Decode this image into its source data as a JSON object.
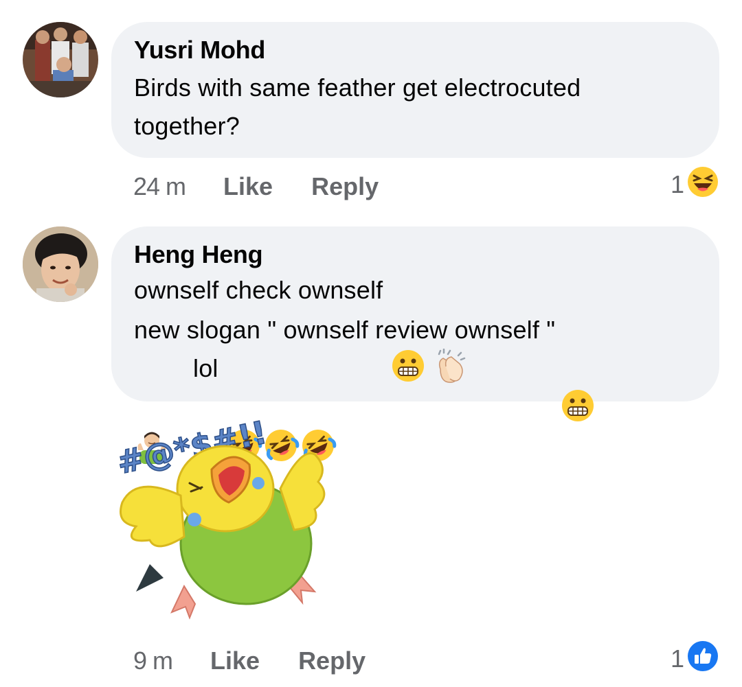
{
  "comments": [
    {
      "author": "Yusri Mohd",
      "lines": [
        "Birds with same feather get electrocuted",
        "together?"
      ],
      "time": "24 m",
      "like_label": "Like",
      "reply_label": "Reply",
      "reaction_count": "1",
      "reaction_icon": "laughing-face-icon"
    },
    {
      "author": "Heng Heng",
      "line1": "ownself check ownself",
      "line2": "new slogan \" ownself review ownself \"",
      "line3": "lol",
      "time": "9 m",
      "like_label": "Like",
      "reply_label": "Reply",
      "reaction_count": "1",
      "reaction_icon": "thumbs-up-icon",
      "sticker": {
        "name": "angry-budgie-sticker",
        "text": "#@*$#!!"
      }
    }
  ],
  "colors": {
    "bubble": "#f0f2f5",
    "meta_text": "#65676b",
    "like_blue": "#1877f2",
    "emoji_yellow": "#ffcc33"
  }
}
